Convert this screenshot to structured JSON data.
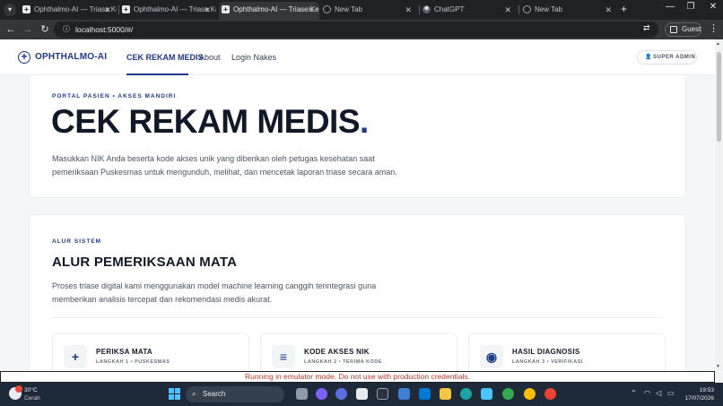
{
  "browser": {
    "tabs": [
      {
        "title": "Ophthalmo-AI — Triase Ke",
        "active": false
      },
      {
        "title": "Ophthalmo-AI — Triase Ke",
        "active": false
      },
      {
        "title": "Ophthalmo-AI — Triase Ke",
        "active": true
      },
      {
        "title": "New Tab",
        "active": false
      },
      {
        "title": "ChatGPT",
        "active": false
      },
      {
        "title": "New Tab",
        "active": false
      }
    ],
    "url": "localhost:5000/#/",
    "profile_label": "Guest"
  },
  "app": {
    "brand": "OPHTHALMO-AI",
    "nav": {
      "cek_rekam_medis": "CEK REKAM MEDIS",
      "about": "About",
      "login_nakes": "Login Nakes"
    },
    "admin_button": "SUPER ADMIN"
  },
  "hero": {
    "kicker": "PORTAL PASIEN • AKSES MANDIRI",
    "title": "CEK REKAM MEDIS",
    "title_dot": ".",
    "description_line1": "Masukkan NIK Anda beserta kode akses unik yang diberikan oleh petugas kesehatan saat",
    "description_line2": "pemeriksaan Puskesmas untuk mengunduh, melihat, dan mencetak laporan triase secara aman."
  },
  "flow": {
    "kicker": "ALUR SISTEM",
    "title": "ALUR PEMERIKSAAN MATA",
    "description_line1": "Proses triase digital kami menggunakan model machine learning canggih terintegrasi guna",
    "description_line2": "memberikan analisis tercepat dan rekomendasi medis akurat.",
    "steps": [
      {
        "title": "PERIKSA MATA",
        "subtitle": "LANGKAH 1 • PUSKESMAS",
        "icon": "plus-icon"
      },
      {
        "title": "KODE AKSES NIK",
        "subtitle": "LANGKAH 2 • TERIMA KODE",
        "icon": "list-icon"
      },
      {
        "title": "HASIL DIAGNOSIS",
        "subtitle": "LANGKAH 3 • VERIFIKASI",
        "icon": "eye-icon"
      }
    ]
  },
  "emulator_banner": "Running in emulator mode. Do not use with production credentials.",
  "taskbar": {
    "temperature": "30°C",
    "weather": "Cerah",
    "search_label": "Search",
    "time": "19:53",
    "date": "17/07/2026"
  },
  "colors": {
    "brand": "#1e3a8a",
    "emulator_text": "#c0392b",
    "taskbar_bg": "#1f2a38"
  }
}
